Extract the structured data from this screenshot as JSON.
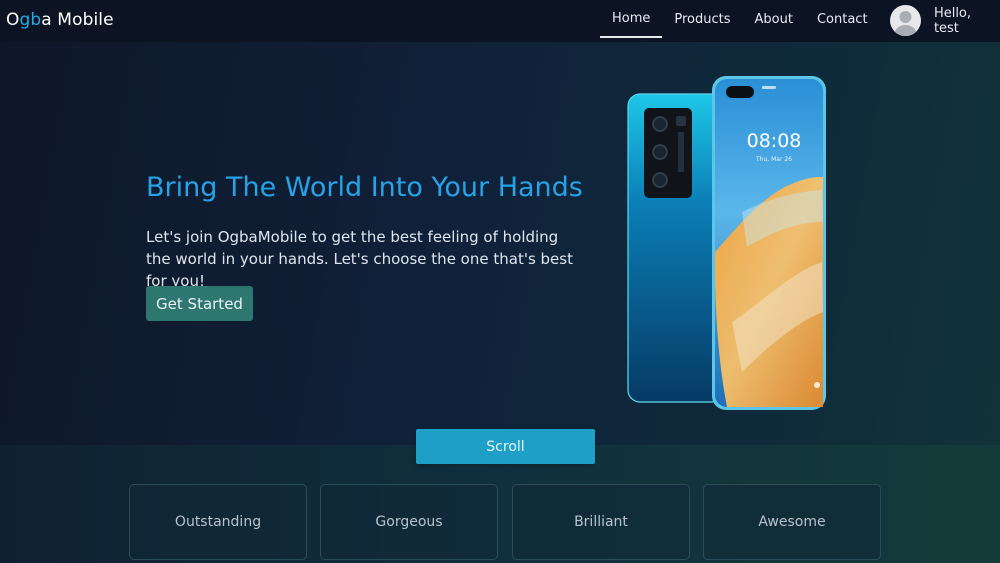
{
  "brand": {
    "part1": "O",
    "part2": "gb",
    "part3": "a Mobile"
  },
  "nav": {
    "items": [
      {
        "label": "Home",
        "active": true
      },
      {
        "label": "Products",
        "active": false
      },
      {
        "label": "About",
        "active": false
      },
      {
        "label": "Contact",
        "active": false
      }
    ]
  },
  "user": {
    "greeting": "Hello, test",
    "avatar_icon": "user-avatar-icon"
  },
  "hero": {
    "title": "Bring The World Into Your Hands",
    "description": "Let's join OgbaMobile to get the best feeling of holding the world in your hands. Let's choose the one that's best for you!",
    "cta_label": "Get Started",
    "phone": {
      "time": "08:08",
      "date": "Thu, Mar 26"
    }
  },
  "scroll_label": "Scroll",
  "features": [
    {
      "label": "Outstanding"
    },
    {
      "label": "Gorgeous"
    },
    {
      "label": "Brilliant"
    },
    {
      "label": "Awesome"
    }
  ],
  "colors": {
    "accent_blue": "#26a3e6",
    "cta_green": "#2e7770",
    "scroll_button": "#1d9fc8",
    "navbar": "#0c1424"
  }
}
